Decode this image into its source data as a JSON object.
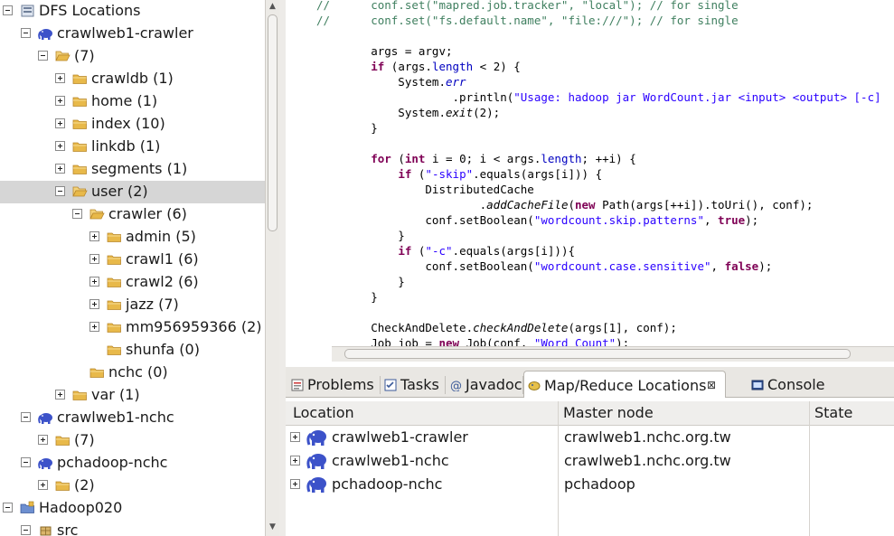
{
  "tree": {
    "items": [
      {
        "label": "DFS Locations",
        "expanded": true,
        "icon": "dfs-icon",
        "selected": false
      },
      {
        "label": "crawlweb1-crawler",
        "expanded": true,
        "icon": "elephant-icon",
        "selected": false
      },
      {
        "label": "(7)",
        "expanded": true,
        "icon": "folder-open-icon",
        "selected": false
      },
      {
        "label": "crawldb (1)",
        "expanded": false,
        "icon": "folder-icon",
        "selected": false
      },
      {
        "label": "home (1)",
        "expanded": false,
        "icon": "folder-icon",
        "selected": false
      },
      {
        "label": "index (10)",
        "expanded": false,
        "icon": "folder-icon",
        "selected": false
      },
      {
        "label": "linkdb (1)",
        "expanded": false,
        "icon": "folder-icon",
        "selected": false
      },
      {
        "label": "segments (1)",
        "expanded": false,
        "icon": "folder-icon",
        "selected": false
      },
      {
        "label": "user (2)",
        "expanded": true,
        "icon": "folder-open-icon",
        "selected": true
      },
      {
        "label": "crawler (6)",
        "expanded": true,
        "icon": "folder-open-icon",
        "selected": false
      },
      {
        "label": "admin (5)",
        "expanded": false,
        "icon": "folder-icon",
        "selected": false
      },
      {
        "label": "crawl1 (6)",
        "expanded": false,
        "icon": "folder-icon",
        "selected": false
      },
      {
        "label": "crawl2 (6)",
        "expanded": false,
        "icon": "folder-icon",
        "selected": false
      },
      {
        "label": "jazz (7)",
        "expanded": false,
        "icon": "folder-icon",
        "selected": false
      },
      {
        "label": "mm956959366 (2)",
        "expanded": false,
        "icon": "folder-icon",
        "selected": false
      },
      {
        "label": "shunfa (0)",
        "expanded": null,
        "icon": "folder-icon",
        "selected": false
      },
      {
        "label": "nchc (0)",
        "expanded": null,
        "icon": "folder-icon",
        "selected": false
      },
      {
        "label": "var (1)",
        "expanded": false,
        "icon": "folder-icon",
        "selected": false
      },
      {
        "label": "crawlweb1-nchc",
        "expanded": true,
        "icon": "elephant-icon",
        "selected": false
      },
      {
        "label": "(7)",
        "expanded": false,
        "icon": "folder-icon",
        "selected": false
      },
      {
        "label": "pchadoop-nchc",
        "expanded": true,
        "icon": "elephant-icon",
        "selected": false
      },
      {
        "label": "(2)",
        "expanded": false,
        "icon": "folder-icon",
        "selected": false
      },
      {
        "label": "Hadoop020",
        "expanded": true,
        "icon": "project-icon",
        "selected": false
      },
      {
        "label": "src",
        "expanded": true,
        "icon": "package-icon",
        "selected": false
      }
    ]
  },
  "editor": {
    "lines": [
      [
        [
          "cm",
          "//      conf.set(\"mapred.job.tracker\", \"local\"); // for single"
        ]
      ],
      [
        [
          "cm",
          "//      conf.set(\"fs.default.name\", \"file:///\"); // for single"
        ]
      ],
      [
        [
          "",
          "  "
        ]
      ],
      [
        [
          "",
          "        args = argv;"
        ]
      ],
      [
        [
          "",
          "        "
        ],
        [
          "kw",
          "if"
        ],
        [
          "",
          " (args."
        ],
        [
          "fld",
          "length"
        ],
        [
          "",
          " < 2) {"
        ]
      ],
      [
        [
          "",
          "            System."
        ],
        [
          "itf",
          "err"
        ]
      ],
      [
        [
          "",
          "                    .println("
        ],
        [
          "str",
          "\"Usage: hadoop jar WordCount.jar <input> <output> [-c]"
        ]
      ],
      [
        [
          "",
          "            System."
        ],
        [
          "it",
          "exit"
        ],
        [
          "",
          "(2);"
        ]
      ],
      [
        [
          "",
          "        }"
        ]
      ],
      [
        [
          "",
          "  "
        ]
      ],
      [
        [
          "",
          "        "
        ],
        [
          "kw",
          "for"
        ],
        [
          "",
          " ("
        ],
        [
          "kw",
          "int"
        ],
        [
          "",
          " i = 0; i < args."
        ],
        [
          "fld",
          "length"
        ],
        [
          "",
          "; ++i) {"
        ]
      ],
      [
        [
          "",
          "            "
        ],
        [
          "kw",
          "if"
        ],
        [
          "",
          " ("
        ],
        [
          "str",
          "\"-skip\""
        ],
        [
          "",
          ".equals(args[i])) {"
        ]
      ],
      [
        [
          "",
          "                DistributedCache"
        ]
      ],
      [
        [
          "",
          "                        ."
        ],
        [
          "it",
          "addCacheFile"
        ],
        [
          "",
          "("
        ],
        [
          "kw",
          "new"
        ],
        [
          "",
          " Path(args[++i]).toUri(), conf);"
        ]
      ],
      [
        [
          "",
          "                conf.setBoolean("
        ],
        [
          "str",
          "\"wordcount.skip.patterns\""
        ],
        [
          "",
          ", "
        ],
        [
          "kw",
          "true"
        ],
        [
          "",
          ");"
        ]
      ],
      [
        [
          "",
          "            }"
        ]
      ],
      [
        [
          "",
          "            "
        ],
        [
          "kw",
          "if"
        ],
        [
          "",
          " ("
        ],
        [
          "str",
          "\"-c\""
        ],
        [
          "",
          ".equals(args[i])){"
        ]
      ],
      [
        [
          "",
          "                conf.setBoolean("
        ],
        [
          "str",
          "\"wordcount.case.sensitive\""
        ],
        [
          "",
          ", "
        ],
        [
          "kw",
          "false"
        ],
        [
          "",
          ");"
        ]
      ],
      [
        [
          "",
          "            }"
        ]
      ],
      [
        [
          "",
          "        }"
        ]
      ],
      [
        [
          "",
          "  "
        ]
      ],
      [
        [
          "",
          "        CheckAndDelete."
        ],
        [
          "it",
          "checkAndDelete"
        ],
        [
          "",
          "(args[1], conf);"
        ]
      ],
      [
        [
          "",
          "        Job job = "
        ],
        [
          "kw",
          "new"
        ],
        [
          "",
          " Job(conf, "
        ],
        [
          "str",
          "\"Word Count\""
        ],
        [
          "",
          ");"
        ]
      ]
    ]
  },
  "tabs": [
    {
      "label": "Problems",
      "icon": "problems-icon",
      "active": false
    },
    {
      "label": "Tasks",
      "icon": "tasks-icon",
      "active": false
    },
    {
      "label": "Javadoc",
      "icon": "javadoc-icon",
      "active": false
    },
    {
      "label": "Map/Reduce Locations",
      "icon": "mapreduce-icon",
      "active": true,
      "close": "⊠"
    },
    {
      "label": "Console",
      "icon": "console-icon",
      "active": false
    }
  ],
  "locations_table": {
    "headers": [
      "Location",
      "Master node",
      "State"
    ],
    "rows": [
      {
        "location": "crawlweb1-crawler",
        "master": "crawlweb1.nchc.org.tw",
        "state": ""
      },
      {
        "location": "crawlweb1-nchc",
        "master": "crawlweb1.nchc.org.tw",
        "state": ""
      },
      {
        "location": "pchadoop-nchc",
        "master": "pchadoop",
        "state": ""
      }
    ]
  },
  "colors": {
    "selection": "#d6d6d6",
    "keyword": "#7f0055",
    "string": "#2a00ff",
    "comment": "#3f7f5f",
    "field": "#0000c0",
    "elephant": "#3c52c9",
    "folder": "#e8b94a"
  }
}
